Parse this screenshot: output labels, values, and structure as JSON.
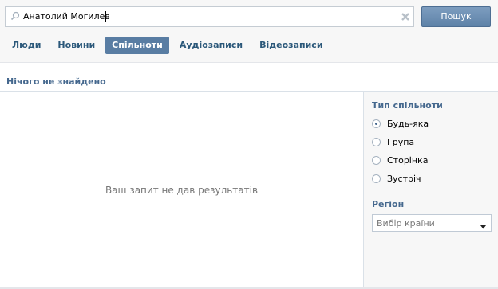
{
  "search": {
    "value": "Анатолий Могилев",
    "button_label": "Пошук",
    "search_icon": "search-icon",
    "clear_icon": "close-icon"
  },
  "tabs": [
    {
      "label": "Люди",
      "active": false
    },
    {
      "label": "Новини",
      "active": false
    },
    {
      "label": "Спільноти",
      "active": true
    },
    {
      "label": "Аудіозаписи",
      "active": false
    },
    {
      "label": "Відеозаписи",
      "active": false
    }
  ],
  "results": {
    "header": "Нічого не знайдено",
    "empty_message": "Ваш запит не дав результатів"
  },
  "filters": {
    "type_title": "Тип спільноти",
    "types": [
      {
        "label": "Будь-яка",
        "checked": true
      },
      {
        "label": "Група",
        "checked": false
      },
      {
        "label": "Сторінка",
        "checked": false
      },
      {
        "label": "Зустріч",
        "checked": false
      }
    ],
    "region_title": "Регіон",
    "region_select": {
      "value": "Вибір країни",
      "icon": "chevron-down-icon"
    }
  },
  "colors": {
    "accent": "#597da3",
    "link": "#2b587a",
    "title": "#45688e"
  }
}
